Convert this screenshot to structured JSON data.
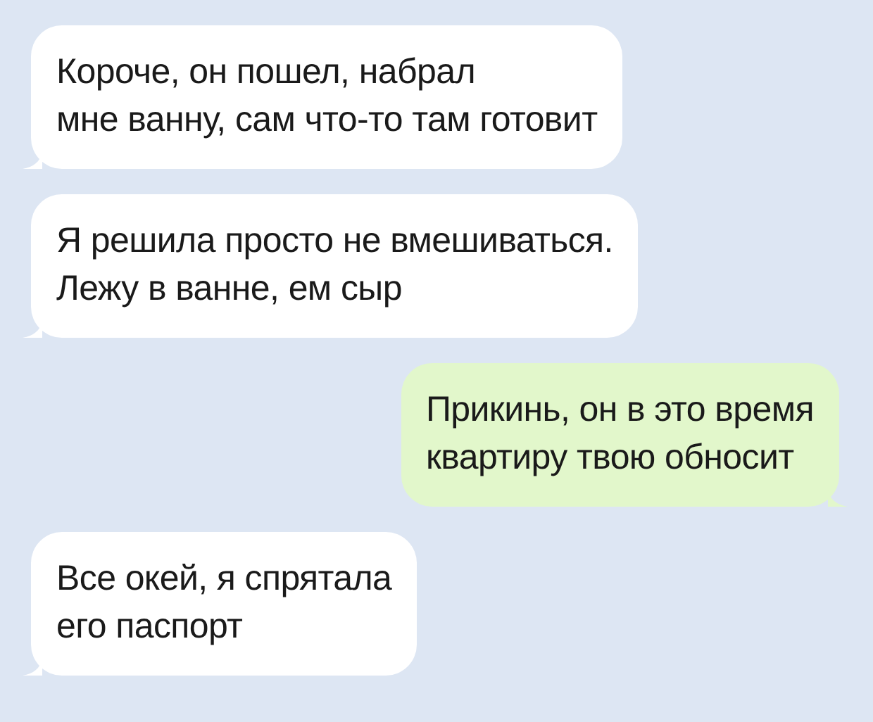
{
  "messages": [
    {
      "kind": "incoming",
      "lines": [
        "Короче, он пошел, набрал",
        "мне ванну, сам что-то там готовит"
      ]
    },
    {
      "kind": "incoming",
      "lines": [
        "Я решила просто не вмешиваться.",
        "Лежу в ванне, ем сыр"
      ]
    },
    {
      "kind": "outgoing",
      "lines": [
        "Прикинь, он в это время",
        "квартиру твою обносит"
      ]
    },
    {
      "kind": "incoming",
      "lines": [
        "Все окей, я спрятала",
        "его паспорт"
      ]
    }
  ]
}
